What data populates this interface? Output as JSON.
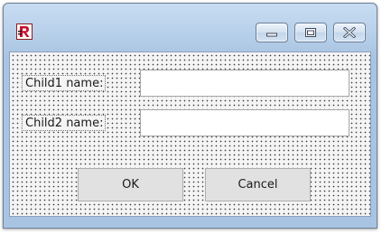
{
  "window": {
    "icon": "fastreport-icon",
    "controls": {
      "minimize": "minimize-icon",
      "maximize": "maximize-icon",
      "close": "close-icon"
    }
  },
  "form": {
    "child1_label": "Child1 name:",
    "child1_value": "",
    "child2_label": "Child2 name:",
    "child2_value": ""
  },
  "buttons": {
    "ok_label": "OK",
    "cancel_label": "Cancel"
  },
  "colors": {
    "title_bar": "#b9d1ea",
    "client_background": "#f4f4f4",
    "grid_dots": "#3c3c3c",
    "button_face": "#e1e1e1",
    "icon_red": "#c8102e"
  }
}
